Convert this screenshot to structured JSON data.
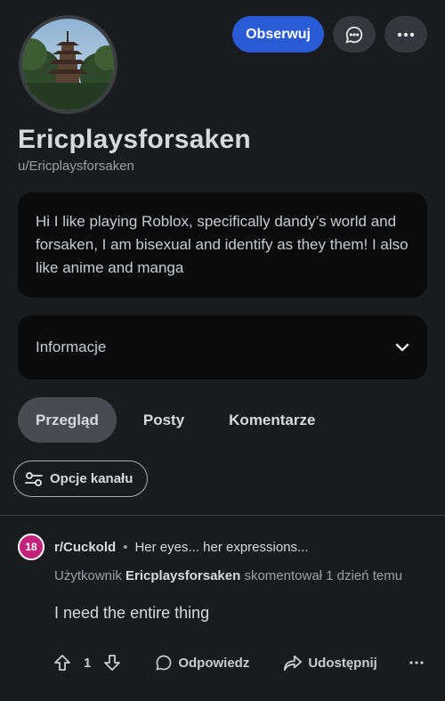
{
  "header": {
    "follow_label": "Obserwuj",
    "chat_icon": "chat-bubble-icon",
    "more_icon": "more-horizontal-icon"
  },
  "profile": {
    "display_name": "Ericplaysforsaken",
    "handle": "u/Ericplaysforsaken",
    "bio": "Hi I like playing Roblox, specifically dandy’s world and forsaken, I am bisexual and identify as they them! I also like anime and manga",
    "info_label": "Informacje"
  },
  "tabs": [
    {
      "label": "Przegląd",
      "active": true
    },
    {
      "label": "Posty",
      "active": false
    },
    {
      "label": "Komentarze",
      "active": false
    }
  ],
  "channel_options_label": "Opcje kanału",
  "comment": {
    "subreddit_badge": "18",
    "subreddit": "r/Cuckold",
    "separator": "•",
    "post_title": "Her eyes... her expressions...",
    "meta_prefix": "Użytkownik",
    "meta_user": "Ericplaysforsaken",
    "meta_suffix": "skomentował 1 dzień temu",
    "text": "I need the entire thing",
    "votes": "1",
    "reply_label": "Odpowiedz",
    "share_label": "Udostępnij"
  },
  "colors": {
    "background": "#1a1b1d",
    "accent": "#2a5bd7",
    "card": "#0b0b0c",
    "nsfw_badge": "#c2227a"
  }
}
